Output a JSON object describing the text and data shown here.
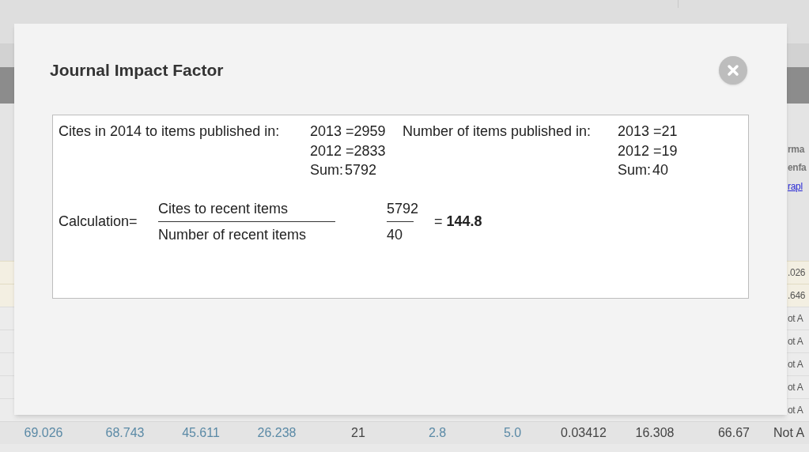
{
  "dialog": {
    "title": "Journal Impact Factor",
    "cites": {
      "label": "Cites in 2014 to items published in:",
      "lines": [
        "2013 =2959",
        "2012 =2833"
      ],
      "sum": {
        "label": "Sum:",
        "value": "5792"
      }
    },
    "items": {
      "label": "Number of items published in:",
      "lines": [
        "2013 =21",
        "2012 =19"
      ],
      "sum": {
        "label": "Sum:",
        "value": "40"
      }
    },
    "calculation": {
      "label": "Calculation=",
      "numerator": "Cites to recent items",
      "denominator": "Number of recent items",
      "numerator_value": "5792",
      "denominator_value": "40",
      "result": "= **144.8**"
    }
  },
  "table": {
    "right_column_header": [
      "rma",
      "enfa"
    ],
    "right_column_link": "rapl",
    "right_column_cells": [
      ".026",
      ".646",
      "ot A",
      "ot A",
      "ot A",
      "ot A",
      "ot A"
    ],
    "last_row": [
      {
        "text": "69.026",
        "kind": "link"
      },
      {
        "text": "68.743",
        "kind": "link"
      },
      {
        "text": "45.611",
        "kind": "link"
      },
      {
        "text": "26.238",
        "kind": "link"
      },
      {
        "text": "21",
        "kind": "plain"
      },
      {
        "text": "2.8",
        "kind": "link"
      },
      {
        "text": "5.0",
        "kind": "link"
      },
      {
        "text": "0.03412",
        "kind": "plain"
      },
      {
        "text": "16.308",
        "kind": "plain"
      },
      {
        "text": "66.67",
        "kind": "plain"
      },
      {
        "text": "Not A",
        "kind": "plain"
      }
    ]
  }
}
